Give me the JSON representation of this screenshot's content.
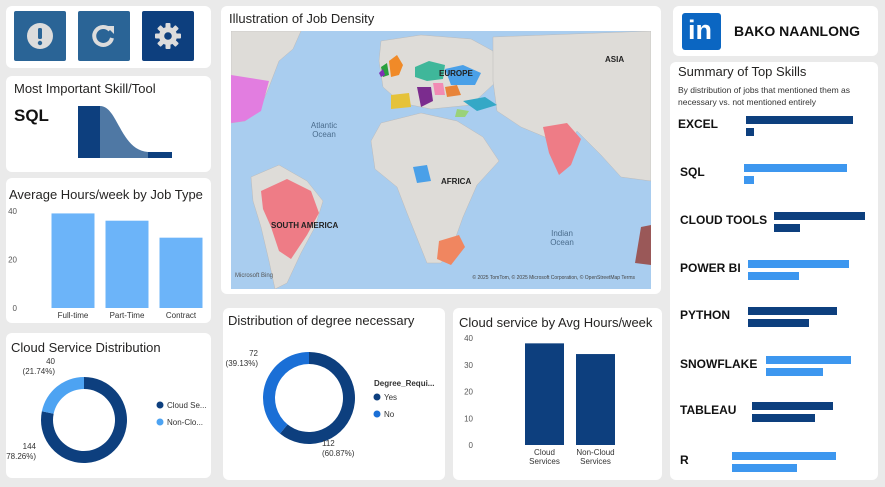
{
  "buttons": [
    {
      "name": "alert-button",
      "icon": "exclamation-icon"
    },
    {
      "name": "refresh-button",
      "icon": "refresh-icon"
    },
    {
      "name": "settings-button",
      "icon": "gear-icon"
    }
  ],
  "skill_card": {
    "title": "Most Important Skill/Tool",
    "value": "SQL"
  },
  "hours_by_type": {
    "title": "Average Hours/week by Job Type",
    "chart_data": {
      "type": "bar",
      "categories": [
        "Full-time",
        "Part-Time",
        "Contract"
      ],
      "values": [
        39,
        36,
        29
      ],
      "yticks": [
        0,
        20,
        40
      ],
      "ylim": [
        0,
        40
      ],
      "color": "#6cb4f9"
    }
  },
  "cloud_dist": {
    "title": "Cloud Service Distribution",
    "chart_data": {
      "type": "pie",
      "slices": [
        {
          "label": "Cloud Se...",
          "value": 144,
          "text": "144",
          "pct": "(78.26%)",
          "color": "#0d3f7e"
        },
        {
          "label": "Non-Clo...",
          "value": 40,
          "text": "40",
          "pct": "(21.74%)",
          "color": "#4da3f2"
        }
      ]
    }
  },
  "map": {
    "title": "Illustration of Job Density",
    "labels": {
      "europe": "EUROPE",
      "asia": "ASIA",
      "africa": "AFRICA",
      "south_america": "SOUTH AMERICA"
    },
    "oceans": {
      "atlantic": "Atlantic Ocean",
      "indian": "Indian Ocean"
    },
    "attribution": "© 2025 TomTom, © 2025 Microsoft Corporation, © OpenStreetMap Terms",
    "brand": "Microsoft Bing"
  },
  "degree": {
    "title": "Distribution of degree necessary",
    "legend_title": "Degree_Requi...",
    "chart_data": {
      "type": "pie",
      "slices": [
        {
          "label": "Yes",
          "value": 112,
          "text": "112",
          "pct": "(60.87%)",
          "color": "#0d3f7e"
        },
        {
          "label": "No",
          "value": 72,
          "text": "72",
          "pct": "(39.13%)",
          "color": "#1a6fd6"
        }
      ]
    }
  },
  "cloud_hours": {
    "title": "Cloud service by Avg Hours/week",
    "chart_data": {
      "type": "bar",
      "categories": [
        "Cloud Services",
        "Non-Cloud Services"
      ],
      "category_lines": [
        [
          "Cloud",
          "Services"
        ],
        [
          "Non-Cloud",
          "Services"
        ]
      ],
      "values": [
        38,
        34
      ],
      "yticks": [
        0,
        10,
        20,
        30,
        40
      ],
      "ylim": [
        0,
        40
      ],
      "color": "#0d3f7e"
    }
  },
  "profile": {
    "logo_text": "in",
    "name": "BAKO NAANLONG"
  },
  "summary": {
    "title": "Summary of Top Skills",
    "subtitle": "By distribution of jobs that mentioned them as necessary vs. not mentioned entirely",
    "chart_data": {
      "type": "bar",
      "series": [
        {
          "name": "mentioned"
        },
        {
          "name": "not mentioned"
        }
      ],
      "skills": [
        {
          "name": "EXCEL",
          "values": [
            108,
            8
          ],
          "color": "#0d3f7e"
        },
        {
          "name": "SQL",
          "values": [
            104,
            10
          ],
          "color": "#3d97ef"
        },
        {
          "name": "CLOUD TOOLS",
          "values": [
            92,
            26
          ],
          "color": "#0d3f7e"
        },
        {
          "name": "POWER BI",
          "values": [
            102,
            52
          ],
          "color": "#3d97ef"
        },
        {
          "name": "PYTHON",
          "values": [
            90,
            62
          ],
          "color": "#0d3f7e"
        },
        {
          "name": "SNOWFLAKE",
          "values": [
            86,
            58
          ],
          "color": "#3d97ef"
        },
        {
          "name": "TABLEAU",
          "values": [
            82,
            64
          ],
          "color": "#0d3f7e"
        },
        {
          "name": "R",
          "values": [
            105,
            66
          ],
          "color": "#3d97ef"
        }
      ]
    }
  }
}
